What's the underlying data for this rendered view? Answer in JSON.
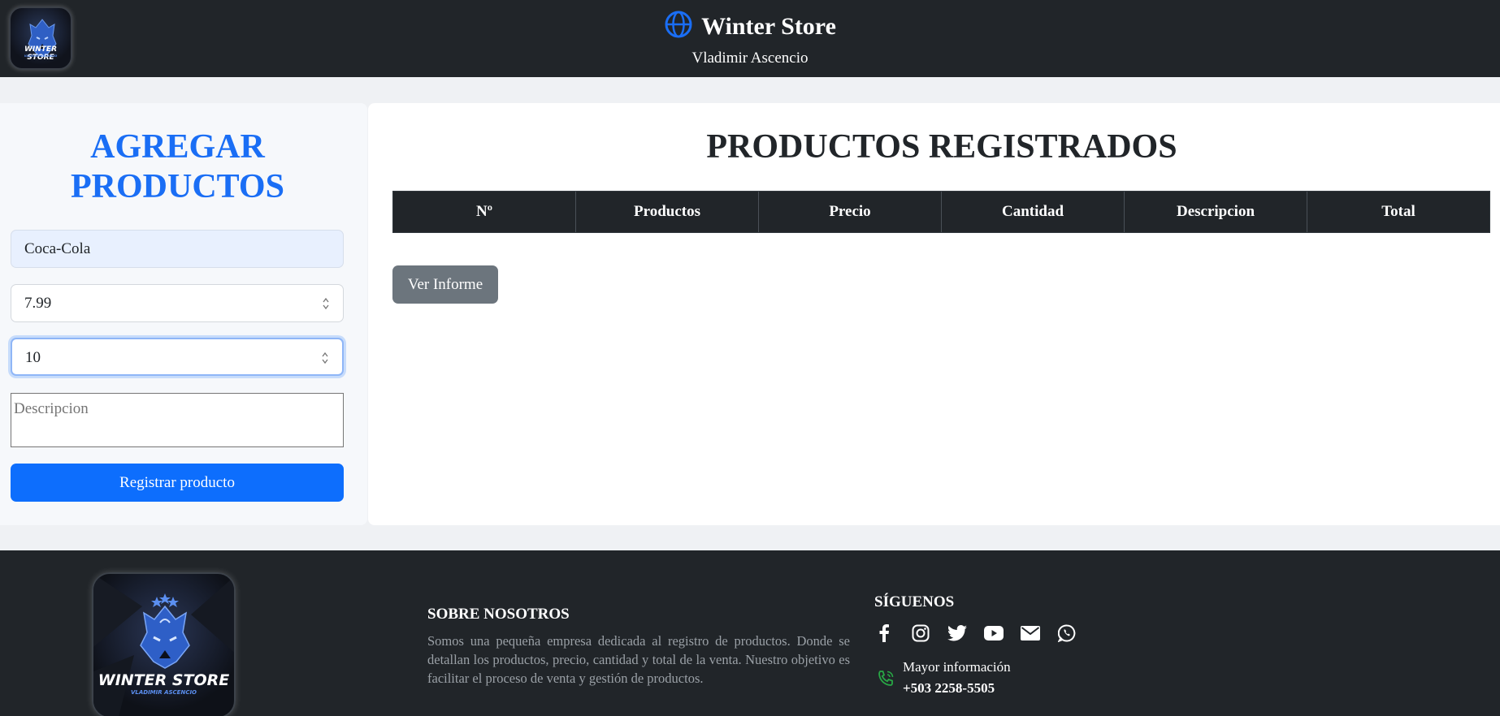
{
  "header": {
    "title": "Winter Store",
    "subtitle": "Vladimir Ascencio",
    "logo_text": "WINTER STORE",
    "logo_subtext": "VLADIMIR ASCENCIO",
    "globe_icon": "globe-icon"
  },
  "form": {
    "title_line1": "AGREGAR",
    "title_line2": "PRODUCTOS",
    "product_value": "Coca-Cola",
    "price_value": "7.99",
    "quantity_value": "10",
    "description_placeholder": "Descripcion",
    "submit_label": "Registrar producto"
  },
  "table": {
    "title": "PRODUCTOS REGISTRADOS",
    "columns": [
      "Nº",
      "Productos",
      "Precio",
      "Cantidad",
      "Descripcion",
      "Total"
    ],
    "rows": []
  },
  "report_button": "Ver Informe",
  "footer": {
    "logo_text": "WINTER STORE",
    "logo_subtext": "VLADIMIR ASCENCIO",
    "about_title": "SOBRE NOSOTROS",
    "about_text": "Somos una pequeña empresa dedicada al registro de productos. Donde se detallan los productos, precio, cantidad y total de la venta. Nuestro objetivo es facilitar el proceso de venta y gestión de productos.",
    "follow_title": "SÍGUENOS",
    "socials": [
      "facebook-icon",
      "instagram-icon",
      "twitter-icon",
      "youtube-icon",
      "email-icon",
      "whatsapp-icon"
    ],
    "contact_label": "Mayor información",
    "contact_phone": "+503 2258-5505"
  },
  "colors": {
    "dark": "#212529",
    "primary": "#0d6efd",
    "title_blue": "#1a6ef5",
    "secondary": "#6c757d",
    "phone_green": "#28a745"
  }
}
